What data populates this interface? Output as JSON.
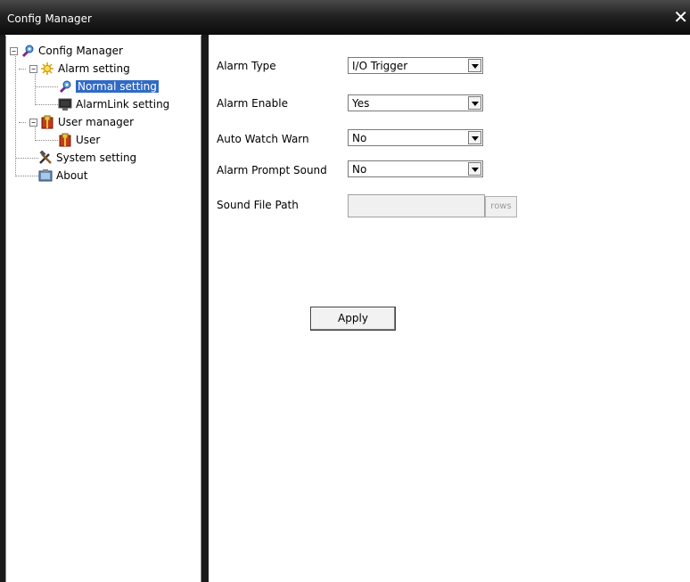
{
  "window": {
    "title": "Config Manager",
    "close_glyph": "✕"
  },
  "tree": {
    "root": {
      "label": "Config Manager",
      "expander": "−",
      "icon": "config-icon"
    },
    "alarm": {
      "label": "Alarm setting",
      "expander": "−",
      "icon": "alarm-icon"
    },
    "normal": {
      "label": "Normal setting",
      "icon": "config-icon",
      "selected": true
    },
    "alarmlink": {
      "label": "AlarmLink setting",
      "icon": "monitor-icon"
    },
    "user_manager": {
      "label": "User manager",
      "expander": "−",
      "icon": "user-icon"
    },
    "user": {
      "label": "User",
      "icon": "user-icon"
    },
    "system": {
      "label": "System setting",
      "icon": "tools-icon"
    },
    "about": {
      "label": "About",
      "icon": "about-icon"
    }
  },
  "form": {
    "alarm_type": {
      "label": "Alarm Type",
      "value": "I/O Trigger"
    },
    "alarm_enable": {
      "label": "Alarm Enable",
      "value": "Yes"
    },
    "auto_watch": {
      "label": "Auto Watch Warn",
      "value": "No"
    },
    "prompt_sound": {
      "label": "Alarm Prompt Sound",
      "value": "No"
    },
    "sound_path": {
      "label": "Sound File Path",
      "value": "",
      "browse_label": "rows"
    },
    "apply_label": "Apply"
  }
}
